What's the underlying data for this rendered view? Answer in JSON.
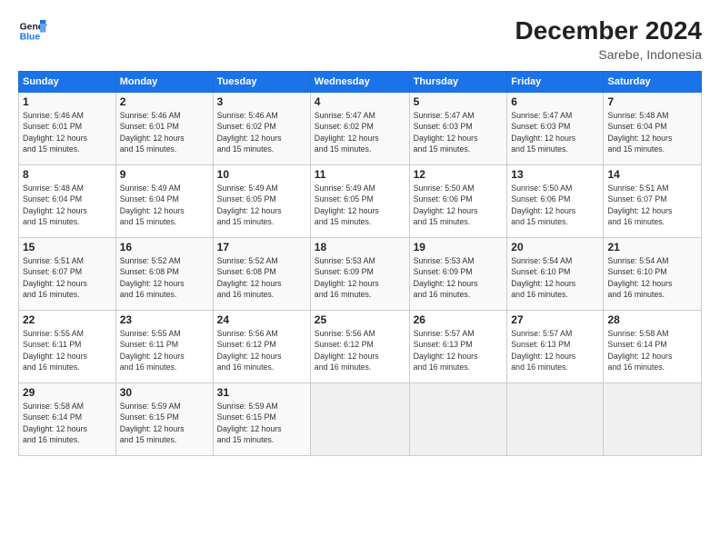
{
  "header": {
    "logo_line1": "General",
    "logo_line2": "Blue",
    "title": "December 2024",
    "subtitle": "Sarebe, Indonesia"
  },
  "days_of_week": [
    "Sunday",
    "Monday",
    "Tuesday",
    "Wednesday",
    "Thursday",
    "Friday",
    "Saturday"
  ],
  "weeks": [
    [
      {
        "day": "1",
        "info": "Sunrise: 5:46 AM\nSunset: 6:01 PM\nDaylight: 12 hours\nand 15 minutes."
      },
      {
        "day": "2",
        "info": "Sunrise: 5:46 AM\nSunset: 6:01 PM\nDaylight: 12 hours\nand 15 minutes."
      },
      {
        "day": "3",
        "info": "Sunrise: 5:46 AM\nSunset: 6:02 PM\nDaylight: 12 hours\nand 15 minutes."
      },
      {
        "day": "4",
        "info": "Sunrise: 5:47 AM\nSunset: 6:02 PM\nDaylight: 12 hours\nand 15 minutes."
      },
      {
        "day": "5",
        "info": "Sunrise: 5:47 AM\nSunset: 6:03 PM\nDaylight: 12 hours\nand 15 minutes."
      },
      {
        "day": "6",
        "info": "Sunrise: 5:47 AM\nSunset: 6:03 PM\nDaylight: 12 hours\nand 15 minutes."
      },
      {
        "day": "7",
        "info": "Sunrise: 5:48 AM\nSunset: 6:04 PM\nDaylight: 12 hours\nand 15 minutes."
      }
    ],
    [
      {
        "day": "8",
        "info": "Sunrise: 5:48 AM\nSunset: 6:04 PM\nDaylight: 12 hours\nand 15 minutes."
      },
      {
        "day": "9",
        "info": "Sunrise: 5:49 AM\nSunset: 6:04 PM\nDaylight: 12 hours\nand 15 minutes."
      },
      {
        "day": "10",
        "info": "Sunrise: 5:49 AM\nSunset: 6:05 PM\nDaylight: 12 hours\nand 15 minutes."
      },
      {
        "day": "11",
        "info": "Sunrise: 5:49 AM\nSunset: 6:05 PM\nDaylight: 12 hours\nand 15 minutes."
      },
      {
        "day": "12",
        "info": "Sunrise: 5:50 AM\nSunset: 6:06 PM\nDaylight: 12 hours\nand 15 minutes."
      },
      {
        "day": "13",
        "info": "Sunrise: 5:50 AM\nSunset: 6:06 PM\nDaylight: 12 hours\nand 15 minutes."
      },
      {
        "day": "14",
        "info": "Sunrise: 5:51 AM\nSunset: 6:07 PM\nDaylight: 12 hours\nand 16 minutes."
      }
    ],
    [
      {
        "day": "15",
        "info": "Sunrise: 5:51 AM\nSunset: 6:07 PM\nDaylight: 12 hours\nand 16 minutes."
      },
      {
        "day": "16",
        "info": "Sunrise: 5:52 AM\nSunset: 6:08 PM\nDaylight: 12 hours\nand 16 minutes."
      },
      {
        "day": "17",
        "info": "Sunrise: 5:52 AM\nSunset: 6:08 PM\nDaylight: 12 hours\nand 16 minutes."
      },
      {
        "day": "18",
        "info": "Sunrise: 5:53 AM\nSunset: 6:09 PM\nDaylight: 12 hours\nand 16 minutes."
      },
      {
        "day": "19",
        "info": "Sunrise: 5:53 AM\nSunset: 6:09 PM\nDaylight: 12 hours\nand 16 minutes."
      },
      {
        "day": "20",
        "info": "Sunrise: 5:54 AM\nSunset: 6:10 PM\nDaylight: 12 hours\nand 16 minutes."
      },
      {
        "day": "21",
        "info": "Sunrise: 5:54 AM\nSunset: 6:10 PM\nDaylight: 12 hours\nand 16 minutes."
      }
    ],
    [
      {
        "day": "22",
        "info": "Sunrise: 5:55 AM\nSunset: 6:11 PM\nDaylight: 12 hours\nand 16 minutes."
      },
      {
        "day": "23",
        "info": "Sunrise: 5:55 AM\nSunset: 6:11 PM\nDaylight: 12 hours\nand 16 minutes."
      },
      {
        "day": "24",
        "info": "Sunrise: 5:56 AM\nSunset: 6:12 PM\nDaylight: 12 hours\nand 16 minutes."
      },
      {
        "day": "25",
        "info": "Sunrise: 5:56 AM\nSunset: 6:12 PM\nDaylight: 12 hours\nand 16 minutes."
      },
      {
        "day": "26",
        "info": "Sunrise: 5:57 AM\nSunset: 6:13 PM\nDaylight: 12 hours\nand 16 minutes."
      },
      {
        "day": "27",
        "info": "Sunrise: 5:57 AM\nSunset: 6:13 PM\nDaylight: 12 hours\nand 16 minutes."
      },
      {
        "day": "28",
        "info": "Sunrise: 5:58 AM\nSunset: 6:14 PM\nDaylight: 12 hours\nand 16 minutes."
      }
    ],
    [
      {
        "day": "29",
        "info": "Sunrise: 5:58 AM\nSunset: 6:14 PM\nDaylight: 12 hours\nand 16 minutes."
      },
      {
        "day": "30",
        "info": "Sunrise: 5:59 AM\nSunset: 6:15 PM\nDaylight: 12 hours\nand 15 minutes."
      },
      {
        "day": "31",
        "info": "Sunrise: 5:59 AM\nSunset: 6:15 PM\nDaylight: 12 hours\nand 15 minutes."
      },
      {
        "day": "",
        "info": ""
      },
      {
        "day": "",
        "info": ""
      },
      {
        "day": "",
        "info": ""
      },
      {
        "day": "",
        "info": ""
      }
    ]
  ]
}
